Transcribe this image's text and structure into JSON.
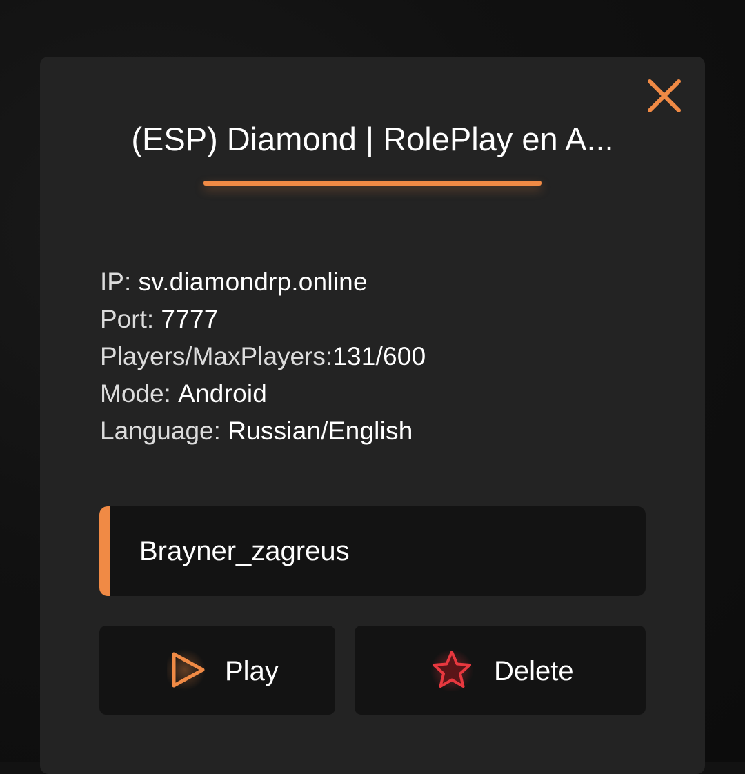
{
  "dialog": {
    "title": "(ESP) Diamond | RolePlay en A...",
    "close_icon": "close-icon",
    "accent_color": "#f08a45"
  },
  "server_info": [
    {
      "key": "IP:",
      "value": "sv.diamondrp.online"
    },
    {
      "key": "Port:",
      "value": "7777"
    },
    {
      "key": "Players/MaxPlayers:",
      "value": "131/600"
    },
    {
      "key": "Mode:",
      "value": "Android"
    },
    {
      "key": "Language:",
      "value": "Russian/English"
    }
  ],
  "nickname": {
    "value": "Brayner_zagreus"
  },
  "actions": {
    "play_label": "Play",
    "play_icon": "play-icon",
    "delete_label": "Delete",
    "delete_icon": "star-icon",
    "delete_color": "#e8383f"
  }
}
